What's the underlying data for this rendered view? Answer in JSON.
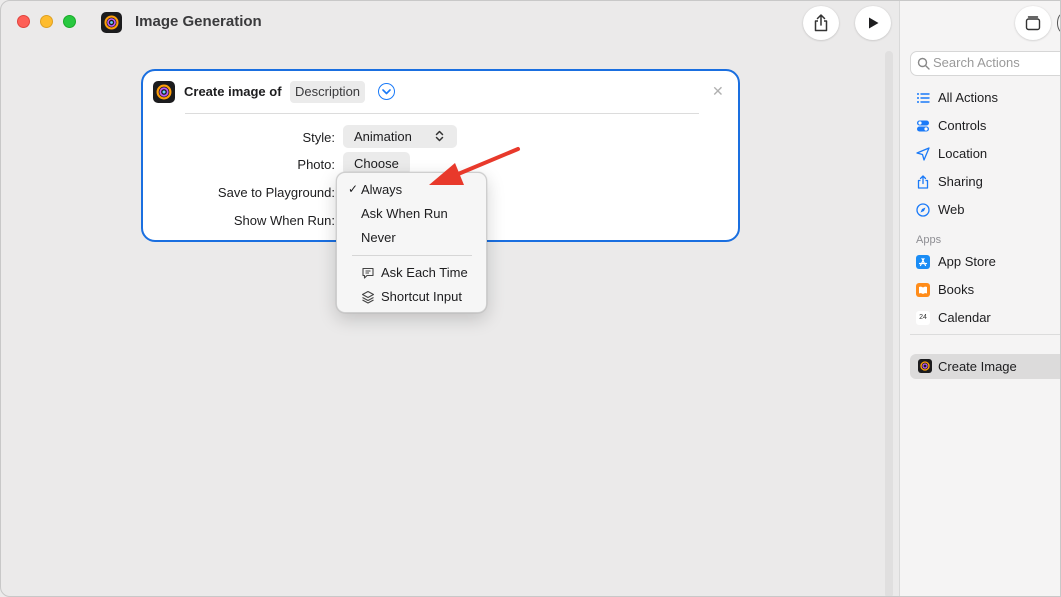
{
  "window": {
    "title": "Image Generation"
  },
  "card": {
    "heading": "Create image of",
    "token": "Description",
    "rows": {
      "style_label": "Style:",
      "style_value": "Animation",
      "photo_label": "Photo:",
      "photo_value": "Choose",
      "save_label": "Save to Playground:",
      "show_label": "Show When Run:"
    }
  },
  "menu": {
    "items": [
      "Always",
      "Ask When Run",
      "Never"
    ],
    "selected": "Always",
    "variables": [
      "Ask Each Time",
      "Shortcut Input"
    ]
  },
  "sidebar": {
    "search_placeholder": "Search Actions",
    "categories": [
      {
        "label": "All Actions",
        "icon": "list-icon"
      },
      {
        "label": "Controls",
        "icon": "toggles-icon"
      },
      {
        "label": "Location",
        "icon": "location-arrow-icon"
      },
      {
        "label": "Sharing",
        "icon": "share-icon"
      },
      {
        "label": "Web",
        "icon": "compass-icon"
      }
    ],
    "apps_header": "Apps",
    "apps": [
      {
        "label": "App Store",
        "icon": "app-store-icon"
      },
      {
        "label": "Books",
        "icon": "books-icon"
      },
      {
        "label": "Calendar",
        "icon": "calendar-icon"
      }
    ],
    "calendar_icon_text": "24",
    "selected": {
      "label": "Create Image",
      "icon": "image-playground-icon"
    }
  },
  "colors": {
    "accent": "#1a6fe0",
    "arrow": "#e8392b"
  }
}
